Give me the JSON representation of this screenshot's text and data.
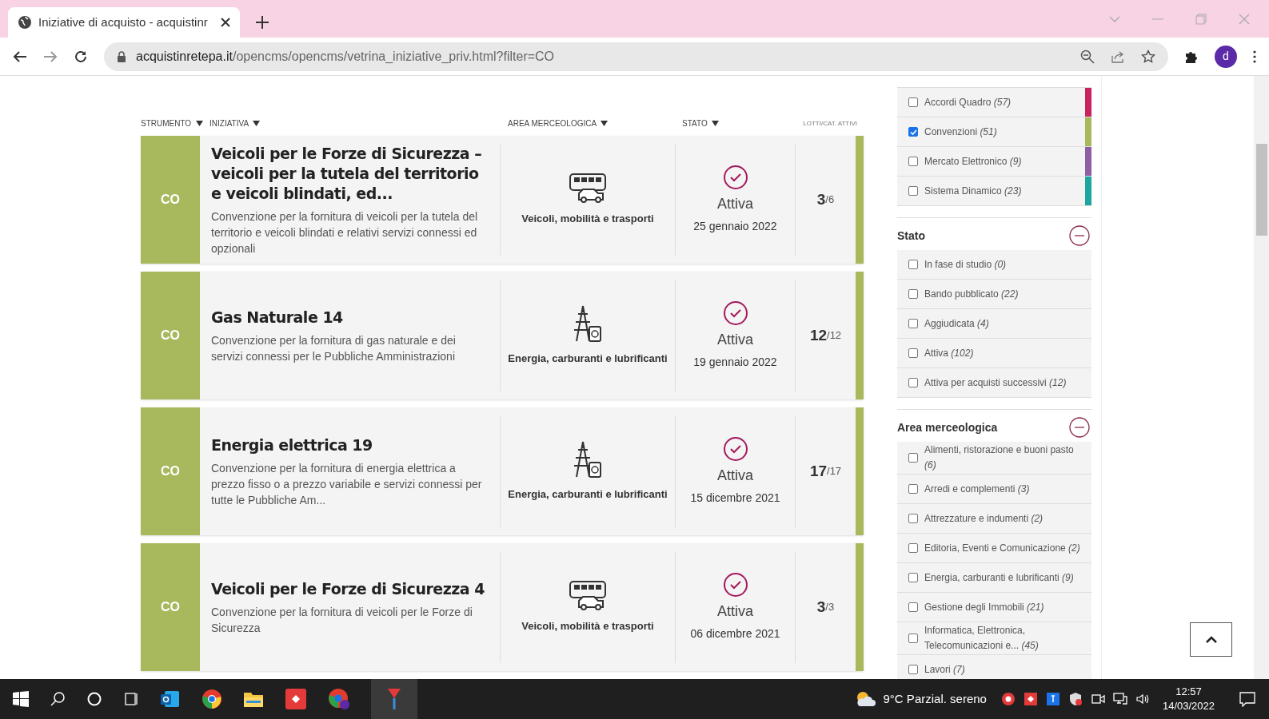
{
  "browser": {
    "tab_title": "Iniziative di acquisto - acquistinr",
    "url_host": "acquistinretepa.it",
    "url_path": "/opencms/opencms/vetrina_iniziative_priv.html?filter=CO",
    "profile": "d"
  },
  "table": {
    "columns": [
      "STRUMENTO",
      "INIZIATIVA",
      "AREA MERCEOLOGICA",
      "STATO",
      "LOTTI/CAT. ATTIVI"
    ],
    "rows": [
      {
        "tool": "CO",
        "title": "Veicoli per le Forze di Sicurezza – veicoli per la tutela del territorio e veicoli blindati, ed...",
        "description": "Convenzione per la fornitura di veicoli per la tutela del territorio e veicoli blindati e relativi servizi connessi ed opzionali",
        "kind": "vehicles",
        "area": "Veicoli, mobilità e trasporti",
        "status": "Attiva",
        "date": "25 gennaio 2022",
        "lots": "3",
        "lots_total": "/6"
      },
      {
        "tool": "CO",
        "title": "Gas Naturale 14",
        "description": "Convenzione per la fornitura di gas naturale e dei servizi connessi per le Pubbliche Amministrazioni",
        "kind": "energy",
        "area": "Energia, carburanti e lubrificanti",
        "status": "Attiva",
        "date": "19 gennaio 2022",
        "lots": "12",
        "lots_total": "/12"
      },
      {
        "tool": "CO",
        "title": "Energia elettrica 19",
        "description": "Convenzione per la fornitura di energia elettrica a prezzo fisso o a prezzo variabile e servizi connessi per tutte le Pubbliche Am...",
        "kind": "energy",
        "area": "Energia, carburanti e lubrificanti",
        "status": "Attiva",
        "date": "15 dicembre 2021",
        "lots": "17",
        "lots_total": "/17"
      },
      {
        "tool": "CO",
        "title": "Veicoli per le Forze di Sicurezza 4",
        "description": "Convenzione per la fornitura di veicoli per le Forze di Sicurezza",
        "kind": "vehicles",
        "area": "Veicoli, mobilità e trasporti",
        "status": "Attiva",
        "date": "06 dicembre 2021",
        "lots": "3",
        "lots_total": "/3"
      }
    ]
  },
  "filters": {
    "tools": [
      {
        "label": "Accordi Quadro",
        "count": "(57)",
        "checked": false,
        "color": "#c8235e"
      },
      {
        "label": "Convenzioni",
        "count": "(51)",
        "checked": true,
        "color": "#a8b85c"
      },
      {
        "label": "Mercato Elettronico",
        "count": "(9)",
        "checked": false,
        "color": "#8e5ea2"
      },
      {
        "label": "Sistema Dinamico",
        "count": "(23)",
        "checked": false,
        "color": "#1fa5a0"
      }
    ],
    "sections": [
      {
        "title": "Stato",
        "items": [
          {
            "label": "In fase di studio",
            "count": "(0)",
            "checked": false
          },
          {
            "label": "Bando pubblicato",
            "count": "(22)",
            "checked": false
          },
          {
            "label": "Aggiudicata",
            "count": "(4)",
            "checked": false
          },
          {
            "label": "Attiva",
            "count": "(102)",
            "checked": false
          },
          {
            "label": "Attiva per acquisti successivi",
            "count": "(12)",
            "checked": false
          }
        ]
      },
      {
        "title": "Area merceologica",
        "items": [
          {
            "label": "Alimenti, ristorazione e buoni pasto",
            "count": "(6)",
            "checked": false
          },
          {
            "label": "Arredi e complementi",
            "count": "(3)",
            "checked": false
          },
          {
            "label": "Attrezzature e indumenti",
            "count": "(2)",
            "checked": false
          },
          {
            "label": "Editoria, Eventi e Comunicazione",
            "count": "(2)",
            "checked": false
          },
          {
            "label": "Energia, carburanti e lubrificanti",
            "count": "(9)",
            "checked": false
          },
          {
            "label": "Gestione degli Immobili",
            "count": "(21)",
            "checked": false
          },
          {
            "label": "Informatica, Elettronica, Telecomunicazioni e...",
            "count": "(45)",
            "checked": false
          },
          {
            "label": "Lavori",
            "count": "(7)",
            "checked": false
          }
        ]
      }
    ]
  },
  "taskbar": {
    "weather": "9°C Parzial. sereno",
    "time": "12:57",
    "date": "14/03/2022"
  }
}
